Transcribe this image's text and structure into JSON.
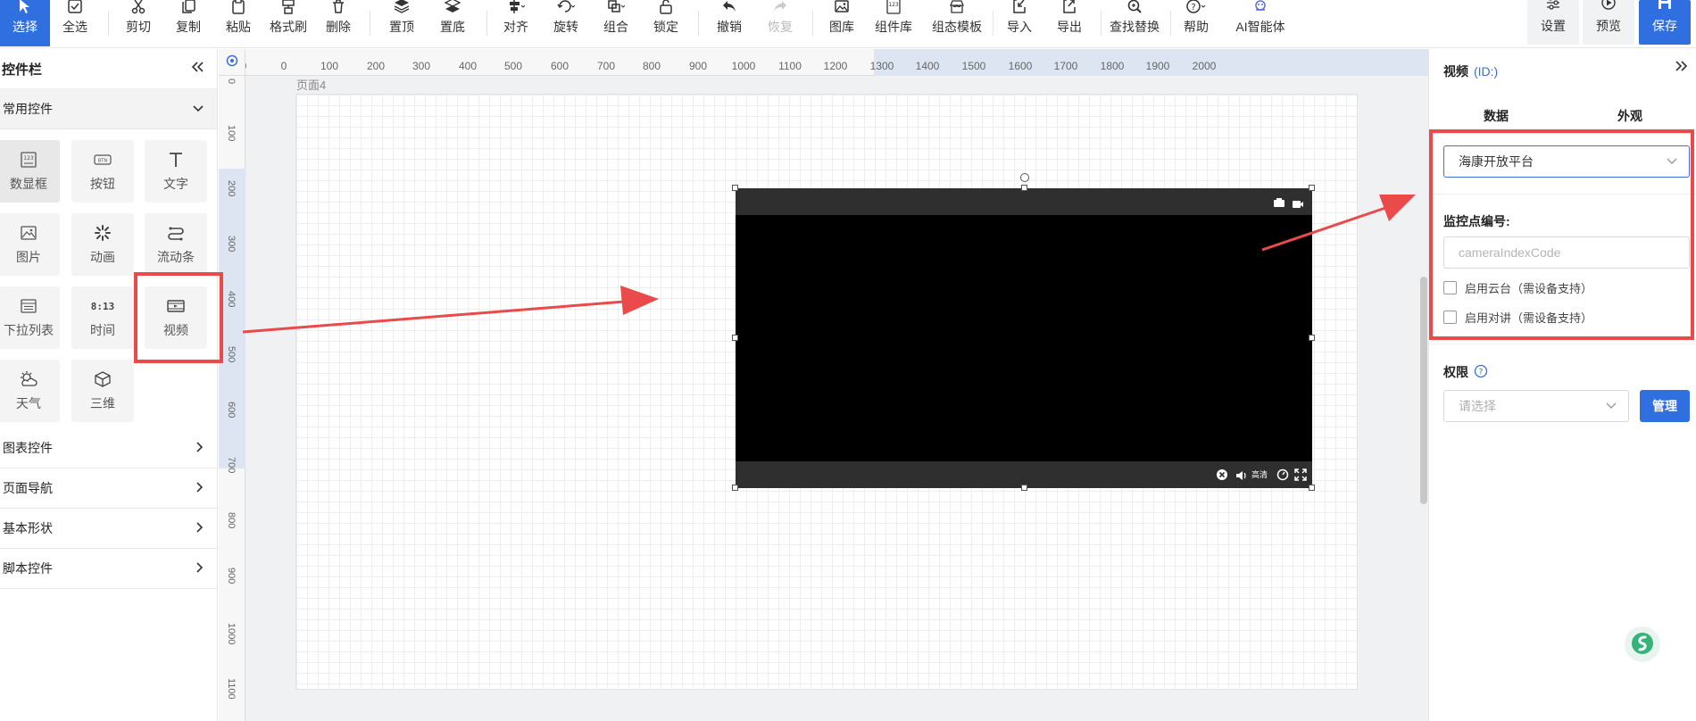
{
  "toolbar": {
    "tools": [
      {
        "label": "选择",
        "icon": "cursor-icon"
      },
      {
        "label": "全选",
        "icon": "select-all-icon"
      },
      {
        "label": "剪切",
        "icon": "scissors-icon"
      },
      {
        "label": "复制",
        "icon": "copy-icon"
      },
      {
        "label": "粘贴",
        "icon": "paste-icon"
      },
      {
        "label": "格式刷",
        "icon": "format-brush-icon"
      },
      {
        "label": "删除",
        "icon": "trash-icon"
      },
      {
        "label": "置顶",
        "icon": "bring-front-icon"
      },
      {
        "label": "置底",
        "icon": "send-back-icon"
      },
      {
        "label": "对齐",
        "icon": "align-icon"
      },
      {
        "label": "旋转",
        "icon": "rotate-icon"
      },
      {
        "label": "组合",
        "icon": "group-icon"
      },
      {
        "label": "锁定",
        "icon": "lock-icon"
      },
      {
        "label": "撤销",
        "icon": "undo-icon"
      },
      {
        "label": "恢复",
        "icon": "redo-icon"
      },
      {
        "label": "图库",
        "icon": "image-library-icon"
      },
      {
        "label": "组件库",
        "icon": "component-library-icon"
      },
      {
        "label": "组态模板",
        "icon": "template-icon"
      },
      {
        "label": "导入",
        "icon": "import-icon"
      },
      {
        "label": "导出",
        "icon": "export-icon"
      },
      {
        "label": "查找替换",
        "icon": "find-replace-icon"
      },
      {
        "label": "帮助",
        "icon": "help-icon"
      },
      {
        "label": "AI智能体",
        "icon": "ai-agent-icon"
      }
    ],
    "settings_label": "设置",
    "preview_label": "预览",
    "save_label": "保存"
  },
  "left_panel": {
    "title": "控件栏",
    "common_section": "常用控件",
    "controls": [
      {
        "label": "数显框",
        "icon": "number-display-icon"
      },
      {
        "label": "按钮",
        "icon": "button-icon"
      },
      {
        "label": "文字",
        "icon": "text-icon"
      },
      {
        "label": "图片",
        "icon": "image-icon"
      },
      {
        "label": "动画",
        "icon": "animation-icon"
      },
      {
        "label": "流动条",
        "icon": "flow-bar-icon"
      },
      {
        "label": "下拉列表",
        "icon": "dropdown-list-icon"
      },
      {
        "label": "时间",
        "icon": "time-icon"
      },
      {
        "label": "视频",
        "icon": "video-icon"
      },
      {
        "label": "天气",
        "icon": "weather-icon"
      },
      {
        "label": "三维",
        "icon": "cube-icon"
      }
    ],
    "time_icon_text": "8:13",
    "categories": [
      "图表控件",
      "页面导航",
      "基本形状",
      "脚本控件"
    ]
  },
  "canvas": {
    "page_name": "页面4",
    "ruler_h": [
      "0",
      "0",
      "100",
      "200",
      "300",
      "400",
      "500",
      "600",
      "700",
      "800",
      "900",
      "1000",
      "1100",
      "1200",
      "1300",
      "1400",
      "1500",
      "1600",
      "1700",
      "1800",
      "1900",
      "2000"
    ],
    "ruler_v": [
      "0",
      "100",
      "200",
      "300",
      "400",
      "500",
      "600",
      "700",
      "800",
      "900",
      "1000",
      "1100"
    ],
    "video_quality_label": "高清"
  },
  "right_panel": {
    "title": "视频",
    "id_label": "(ID:)",
    "tabs": [
      "数据",
      "外观"
    ],
    "platform_value": "海康开放平台",
    "camera_label": "监控点编号:",
    "camera_placeholder": "cameraIndexCode",
    "ptz_label": "启用云台（需设备支持）",
    "talk_label": "启用对讲（需设备支持）",
    "permission_label": "权限",
    "permission_placeholder": "请选择",
    "manage_label": "管理"
  },
  "colors": {
    "accent": "#2f6fdf",
    "annotation": "#ea4a4a"
  }
}
